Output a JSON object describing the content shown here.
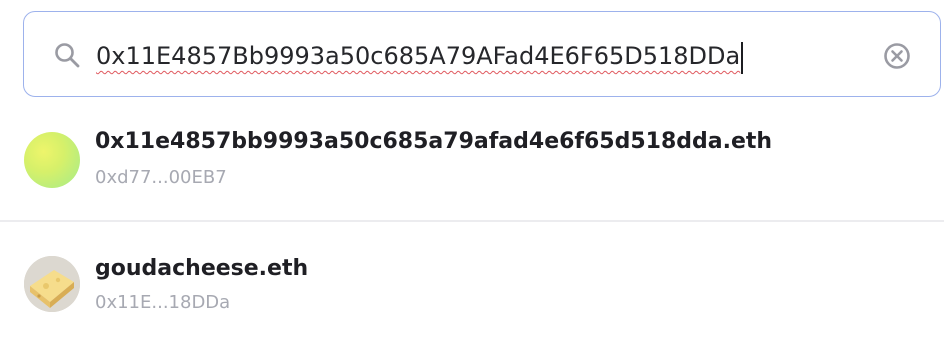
{
  "search": {
    "value": "0x11E4857Bb9993a50c685A79AFad4E6F65D518DDa",
    "icon": "search-icon",
    "clear_icon": "close-circle-icon"
  },
  "results": [
    {
      "name": "0x11e4857bb9993a50c685a79afad4e6f65d518dda.eth",
      "address": "0xd77...00EB7",
      "avatar": "gradient-avatar"
    },
    {
      "name": "goudacheese.eth",
      "address": "0x11E...18DDa",
      "avatar": "cheese-avatar"
    }
  ],
  "colors": {
    "border": "#9db2ec",
    "text": "#1f1f24",
    "muted": "#a7a9b2",
    "icon": "#9a9ba3"
  }
}
